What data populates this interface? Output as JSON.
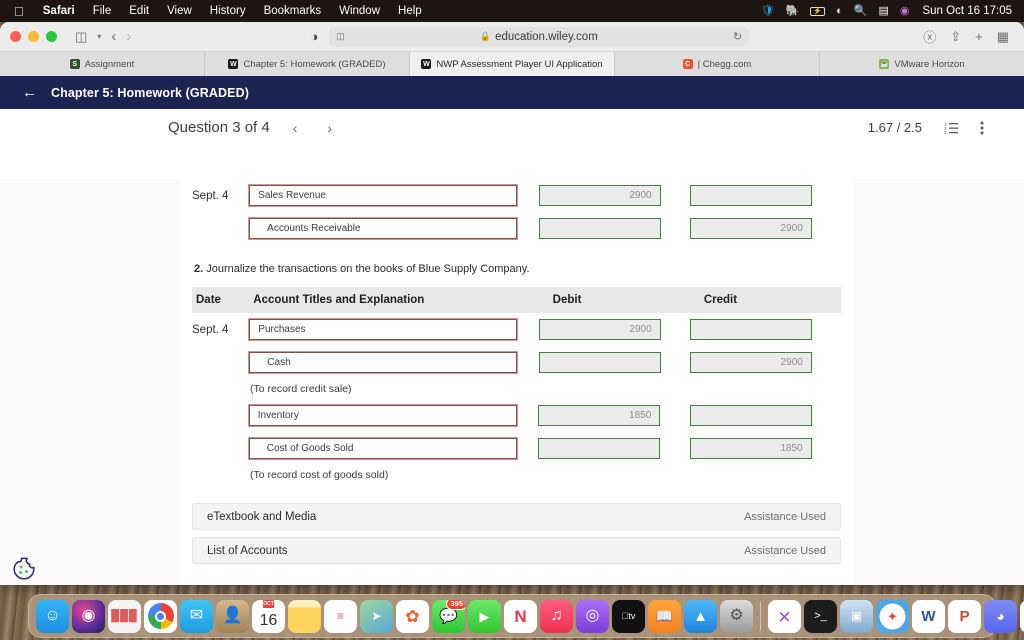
{
  "menubar": {
    "apple": "apple-logo",
    "items": [
      "Safari",
      "File",
      "Edit",
      "View",
      "History",
      "Bookmarks",
      "Window",
      "Help"
    ],
    "status_icons": [
      "shield-icon",
      "elephant-icon",
      "battery-icon",
      "wifi-icon",
      "search-icon",
      "display-icon",
      "siri-icon"
    ],
    "clock": "Sun Oct 16  17:05"
  },
  "browser": {
    "url": "education.wiley.com",
    "lock": "lock-icon",
    "reader": "reader-icon",
    "reload": "reload-icon",
    "sidebar": "sidebar-icon",
    "back": "‹",
    "forward": "›",
    "shield": "privacy-shield-icon",
    "downloads": "download-icon",
    "share": "share-icon",
    "newtab": "+",
    "taboverview": "tab-overview-icon",
    "tabs": [
      {
        "label": "Assignment",
        "favicon": "assignment-favicon",
        "letter": "S",
        "active": false
      },
      {
        "label": "Chapter 5: Homework (GRADED)",
        "favicon": "wiley-favicon",
        "letter": "W",
        "active": false
      },
      {
        "label": "NWP Assessment Player UI Application",
        "favicon": "wiley-favicon",
        "letter": "W",
        "active": true
      },
      {
        "label": "| Chegg.com",
        "favicon": "chegg-favicon",
        "letter": "C",
        "active": false
      },
      {
        "label": "VMware Horizon",
        "favicon": "vmware-favicon",
        "letter": "",
        "active": false
      }
    ]
  },
  "app": {
    "back_arrow": "back-arrow-icon",
    "title": "Chapter 5: Homework (GRADED)",
    "question_label": "Question 3 of 4",
    "prev": "‹",
    "next": "›",
    "score": "1.67 / 2.5",
    "list_icon": "ordered-list-icon",
    "more_icon": "more-vertical-icon"
  },
  "table1": {
    "rows": [
      {
        "date": "Sept. 4",
        "account": "Sales Revenue",
        "indent": false,
        "debit": "2900",
        "credit": ""
      },
      {
        "date": "",
        "account": "Accounts Receivable",
        "indent": true,
        "debit": "",
        "credit": "2900"
      }
    ]
  },
  "instruction": {
    "number": "2.",
    "text": " Journalize the transactions on the books of Blue Supply Company."
  },
  "table2": {
    "headers": {
      "date": "Date",
      "account": "Account Titles and Explanation",
      "debit": "Debit",
      "credit": "Credit"
    },
    "rows": [
      {
        "date": "Sept. 4",
        "account": "Purchases",
        "indent": false,
        "debit": "2900",
        "credit": ""
      },
      {
        "date": "",
        "account": "Cash",
        "indent": true,
        "debit": "",
        "credit": "2900"
      }
    ],
    "note1": "(To record credit sale)",
    "rows2": [
      {
        "date": "",
        "account": "Inventory",
        "indent": false,
        "debit": "1850",
        "credit": ""
      },
      {
        "date": "",
        "account": "Cost of Goods Sold",
        "indent": true,
        "debit": "",
        "credit": "1850"
      }
    ],
    "note2": "(To record cost of goods sold)"
  },
  "footer": {
    "rows": [
      {
        "label": "eTextbook and Media",
        "status": "Assistance Used"
      },
      {
        "label": "List of Accounts",
        "status": "Assistance Used"
      }
    ]
  },
  "cookie_widget": {
    "name": "cookie-consent-icon"
  },
  "dock": {
    "apps": [
      {
        "name": "finder",
        "glyph": "☺",
        "bg": "linear-gradient(180deg,#36b4f5,#1b8fe0)",
        "running": true
      },
      {
        "name": "siri",
        "glyph": "◉",
        "bg": "radial-gradient(circle at 35% 30%,#e0478f,#5b2c9e 60%,#1b1b3a)",
        "running": false
      },
      {
        "name": "launchpad",
        "glyph": "∷",
        "bg": "#f2f2f2",
        "running": false
      },
      {
        "name": "google-chrome",
        "glyph": "◉",
        "bg": "#fff",
        "running": true
      },
      {
        "name": "mail",
        "glyph": "✉",
        "bg": "linear-gradient(180deg,#3ec6f5,#1f9be0)",
        "running": false
      },
      {
        "name": "contacts",
        "glyph": "☺",
        "bg": "linear-gradient(180deg,#c9a882,#9a7b53)",
        "running": false
      },
      {
        "name": "calendar",
        "glyph": "16",
        "bg": "#fff",
        "running": false
      },
      {
        "name": "notes",
        "glyph": "",
        "bg": "linear-gradient(180deg,#fde08a,#fbd35c)",
        "running": true
      },
      {
        "name": "reminders",
        "glyph": "≡",
        "bg": "#fff",
        "running": false
      },
      {
        "name": "maps",
        "glyph": "➤",
        "bg": "linear-gradient(180deg,#8fd18a,#4aa0d8)",
        "running": false
      },
      {
        "name": "photos",
        "glyph": "✿",
        "bg": "#fff",
        "running": true
      },
      {
        "name": "messages",
        "glyph": "●",
        "bg": "linear-gradient(180deg,#6ce96c,#2ec62e)",
        "running": true,
        "badge": "395"
      },
      {
        "name": "facetime",
        "glyph": "▶",
        "bg": "linear-gradient(180deg,#6ce96c,#2ec62e)",
        "running": false
      },
      {
        "name": "news",
        "glyph": "N",
        "bg": "#fff",
        "running": false
      },
      {
        "name": "music",
        "glyph": "♪",
        "bg": "linear-gradient(180deg,#fc5c7d,#f0334f)",
        "running": true
      },
      {
        "name": "podcasts",
        "glyph": "◎",
        "bg": "linear-gradient(180deg,#9b5cf6,#7a3fd6)",
        "running": false
      },
      {
        "name": "apple-tv",
        "glyph": " tv",
        "bg": "#111",
        "running": true
      },
      {
        "name": "books",
        "glyph": "☷",
        "bg": "linear-gradient(180deg,#ffa53c,#f5821f)",
        "running": false
      },
      {
        "name": "app-store",
        "glyph": "A",
        "bg": "linear-gradient(180deg,#4db8f5,#1f84e0)",
        "running": false
      },
      {
        "name": "system-preferences",
        "glyph": "⚙",
        "bg": "linear-gradient(180deg,#d8d8d8,#9a9a9a)",
        "running": false
      }
    ],
    "apps2": [
      {
        "name": "visual-studio",
        "glyph": "✕",
        "bg": "#fff",
        "running": true
      },
      {
        "name": "terminal",
        "glyph": ">_",
        "bg": "#1c1c1c",
        "running": true
      },
      {
        "name": "preview",
        "glyph": "▤",
        "bg": "linear-gradient(180deg,#cfe4f2,#8fb6d6)",
        "running": true
      },
      {
        "name": "safari",
        "glyph": "✦",
        "bg": "#fff",
        "running": true
      },
      {
        "name": "microsoft-word",
        "glyph": "W",
        "bg": "#fff",
        "running": true
      },
      {
        "name": "microsoft-powerpoint",
        "glyph": "P",
        "bg": "#fff",
        "running": true
      },
      {
        "name": "discord",
        "glyph": "◑",
        "bg": "linear-gradient(180deg,#7b8cf0,#5865f2)",
        "running": true
      },
      {
        "name": "vs-code",
        "glyph": "✕",
        "bg": "#fff",
        "running": true
      }
    ],
    "minimized": [
      "minimized-window-1",
      "minimized-window-2",
      "minimized-window-3"
    ],
    "trash": "trash-icon"
  }
}
